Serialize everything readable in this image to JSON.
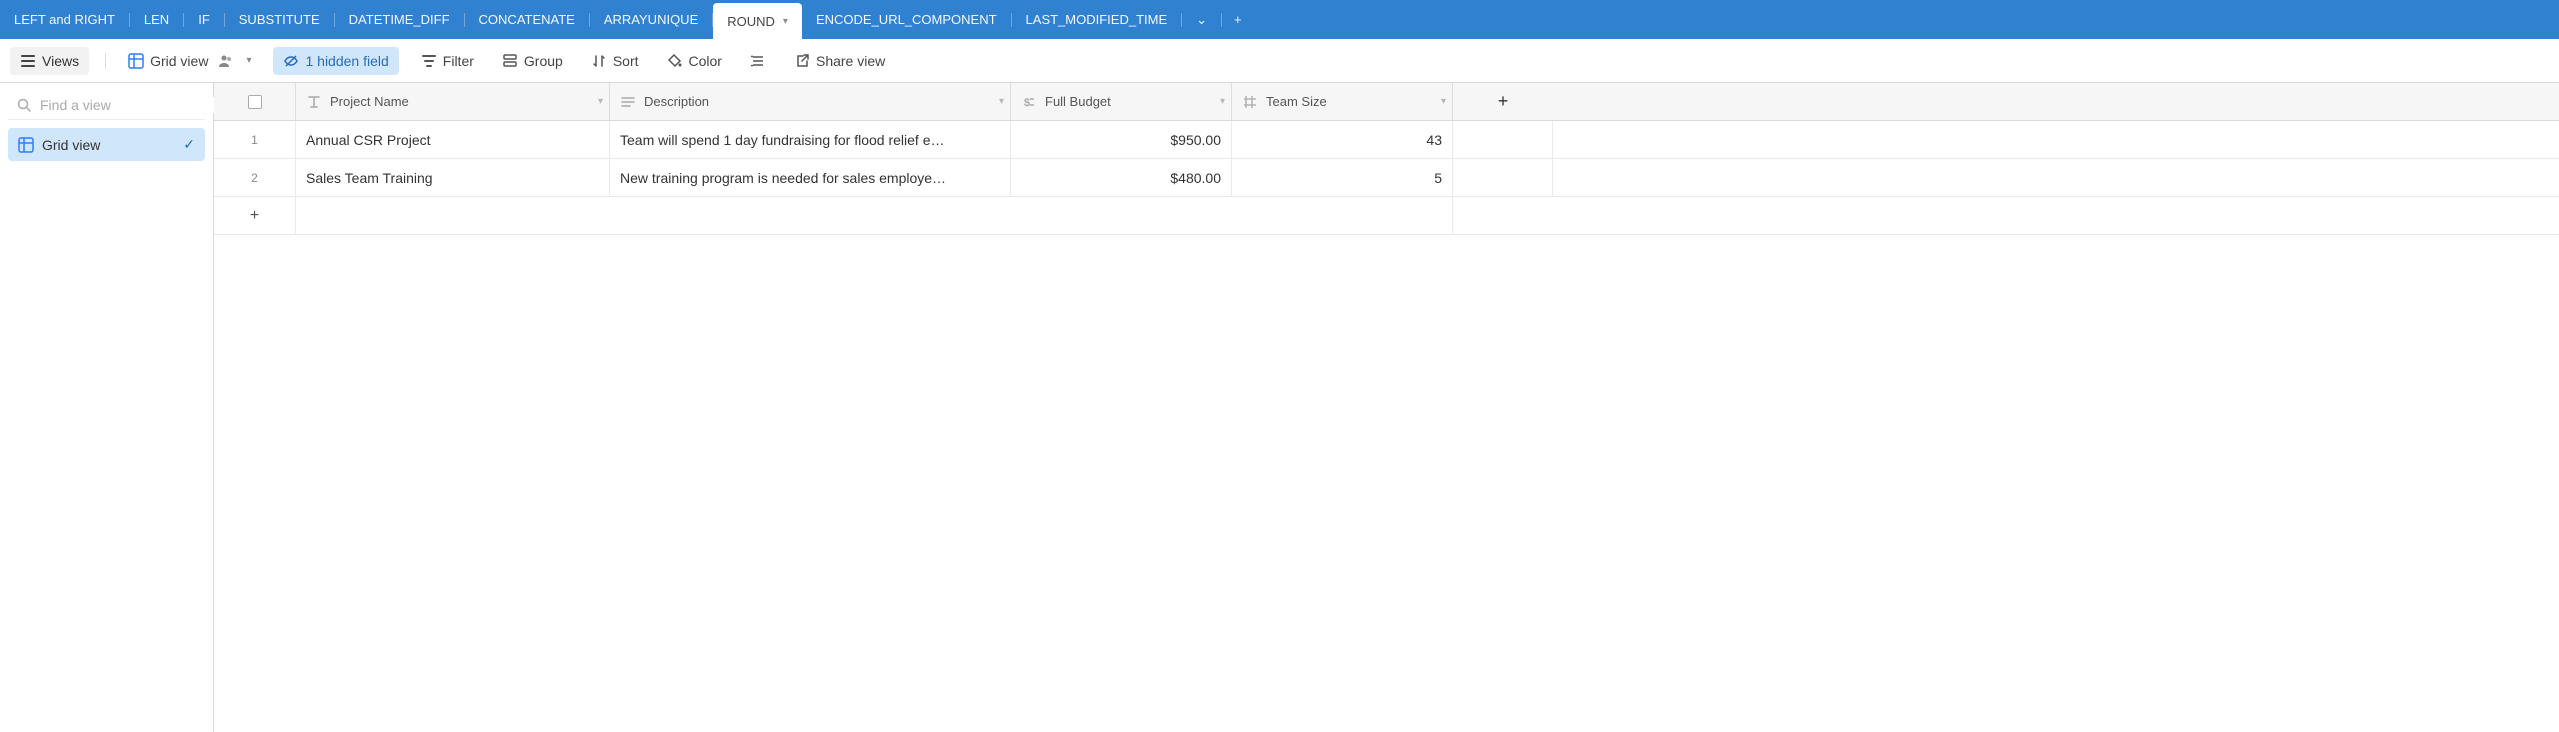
{
  "tabs": {
    "items": [
      {
        "label": "LEFT and RIGHT",
        "active": false
      },
      {
        "label": "LEN",
        "active": false
      },
      {
        "label": "IF",
        "active": false
      },
      {
        "label": "SUBSTITUTE",
        "active": false
      },
      {
        "label": "DATETIME_DIFF",
        "active": false
      },
      {
        "label": "CONCATENATE",
        "active": false
      },
      {
        "label": "ARRAYUNIQUE",
        "active": false
      },
      {
        "label": "ROUND",
        "active": true
      },
      {
        "label": "ENCODE_URL_COMPONENT",
        "active": false
      },
      {
        "label": "LAST_MODIFIED_TIME",
        "active": false
      }
    ]
  },
  "toolbar": {
    "views": "Views",
    "grid_view": "Grid view",
    "hidden": "1 hidden field",
    "filter": "Filter",
    "group": "Group",
    "sort": "Sort",
    "color": "Color",
    "share": "Share view"
  },
  "sidebar": {
    "search_placeholder": "Find a view",
    "views": [
      {
        "label": "Grid view",
        "active": true
      }
    ]
  },
  "grid": {
    "columns": [
      {
        "name": "Project Name",
        "type": "text"
      },
      {
        "name": "Description",
        "type": "longtext"
      },
      {
        "name": "Full Budget",
        "type": "currency"
      },
      {
        "name": "Team Size",
        "type": "number"
      }
    ],
    "rows": [
      {
        "num": "1",
        "project": "Annual CSR Project",
        "desc": "Team will spend 1 day fundraising for flood relief e…",
        "budget": "$950.00",
        "team": "43"
      },
      {
        "num": "2",
        "project": "Sales Team Training",
        "desc": "New training program is needed for sales employe…",
        "budget": "$480.00",
        "team": "5"
      }
    ]
  }
}
